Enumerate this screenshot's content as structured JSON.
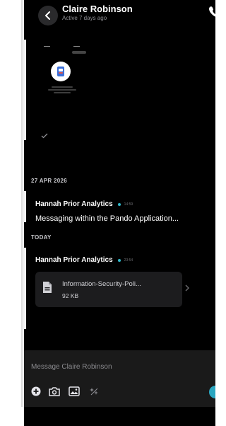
{
  "header": {
    "contact_name": "Claire Robinson",
    "status": "Active 7 days ago",
    "icons": {
      "back": "chevron-left-icon",
      "call": "phone-icon"
    }
  },
  "separators": {
    "first": "27 APR 2026",
    "today": "TODAY"
  },
  "messages": [
    {
      "sender": "Hannah Prior Analytics",
      "time": "14:59",
      "text": "Messaging within the Pando Application..."
    },
    {
      "sender": "Hannah Prior Analytics",
      "time": "23:54",
      "attachment": {
        "name": "Information-Security-Poli...",
        "size": "92 KB",
        "icon": "document-icon"
      }
    }
  ],
  "composer": {
    "placeholder": "Message Claire Robinson",
    "tools": [
      "add-icon",
      "camera-icon",
      "image-icon",
      "sparkle-icon"
    ]
  },
  "colors": {
    "background": "#000000",
    "accent": "#2fb7c9",
    "card": "#1c1c1e",
    "composer": "#1a1a1a"
  }
}
